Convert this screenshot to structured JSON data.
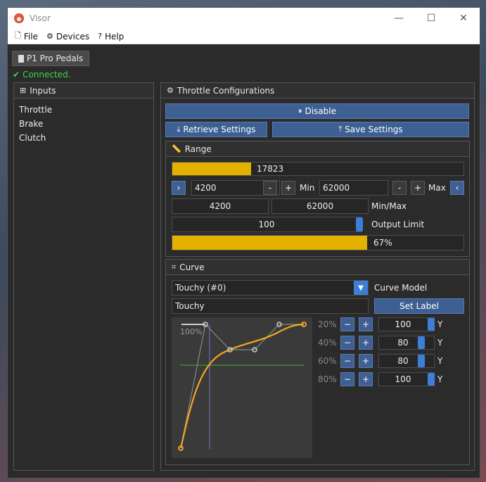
{
  "window": {
    "title": "Visor",
    "minimize": "—",
    "maximize": "☐",
    "close": "✕"
  },
  "menu": {
    "file": "File",
    "devices": "Devices",
    "help": "Help"
  },
  "device_tab": "P1 Pro Pedals",
  "status": "Connected.",
  "inputs": {
    "header": "Inputs",
    "items": [
      "Throttle",
      "Brake",
      "Clutch"
    ]
  },
  "config": {
    "header": "Throttle Configurations",
    "disable": "Disable",
    "retrieve": "Retrieve Settings",
    "save": "Save Settings"
  },
  "range": {
    "header": "Range",
    "live_value": "17823",
    "live_fraction": 0.271,
    "min_value": "4200",
    "min_label": "Min",
    "max_value": "62000",
    "max_label": "Max",
    "minmax_min": "4200",
    "minmax_max": "62000",
    "minmax_label": "Min/Max",
    "output_limit": "100",
    "output_limit_label": "Output Limit",
    "output_limit_fraction": 1.0,
    "percent_text": "67%",
    "percent_fraction": 0.67,
    "minus": "-",
    "plus": "+",
    "left_arrow": "‹",
    "right_arrow": "›"
  },
  "curve": {
    "header": "Curve",
    "model_selected": "Touchy (#0)",
    "model_label": "Curve Model",
    "label_value": "Touchy",
    "set_label": "Set Label",
    "graph_label": "100%",
    "points": [
      {
        "pct": "20%",
        "value": "100",
        "fraction": 1.0,
        "y_label": "Y"
      },
      {
        "pct": "40%",
        "value": "80",
        "fraction": 0.8,
        "y_label": "Y"
      },
      {
        "pct": "60%",
        "value": "80",
        "fraction": 0.8,
        "y_label": "Y"
      },
      {
        "pct": "80%",
        "value": "100",
        "fraction": 1.0,
        "y_label": "Y"
      }
    ],
    "minus": "−",
    "plus": "+"
  },
  "colors": {
    "accent_blue": "#3d5f92",
    "handle_blue": "#3d7fd8",
    "fill_yellow": "#e3b100",
    "curve_orange": "#f5a623",
    "status_green": "#3fd44f"
  }
}
